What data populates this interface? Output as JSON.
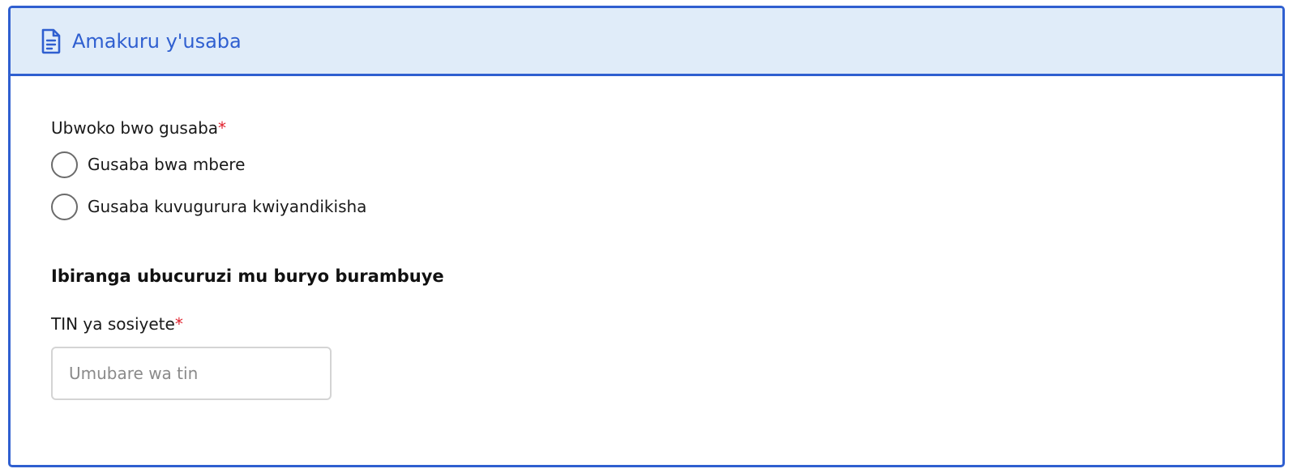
{
  "header": {
    "title": "Amakuru y'usaba",
    "icon": "document-icon",
    "accent_color": "#2f5fd0",
    "background_color": "#e0ecf9"
  },
  "application_type": {
    "label": "Ubwoko bwo gusaba",
    "required_mark": "*",
    "options": [
      {
        "label": "Gusaba bwa mbere",
        "selected": false
      },
      {
        "label": "Gusaba kuvugurura kwiyandikisha",
        "selected": false
      }
    ]
  },
  "section": {
    "heading": "Ibiranga ubucuruzi mu buryo burambuye"
  },
  "tin": {
    "label": "TIN ya sosiyete",
    "required_mark": "*",
    "placeholder": "Umubare wa tin",
    "value": ""
  }
}
